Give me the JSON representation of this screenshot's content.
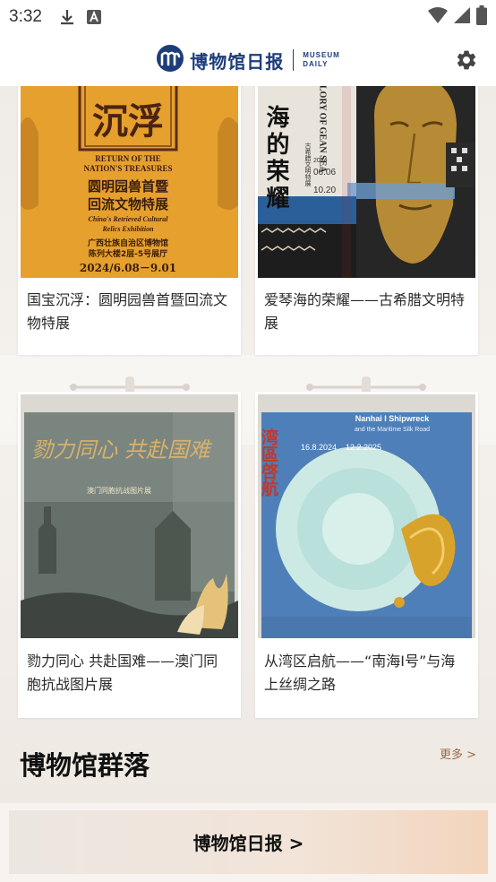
{
  "status_bar": {
    "time": "3:32"
  },
  "header": {
    "logo_cn": "博物馆日报",
    "logo_en_line1": "MUSEUM",
    "logo_en_line2": "DAILY"
  },
  "exhibitions": [
    {
      "title": "国宝沉浮：圆明园兽首暨回流文物特展",
      "poster": {
        "cn_big": "沉浮",
        "en_line1": "RETURN OF THE",
        "en_line2": "NATION'S TREASURES",
        "cn_sub1": "圆明园兽首暨",
        "cn_sub2": "回流文物特展",
        "en_sub1": "China's Retrieved Cultural",
        "en_sub2": "Relics Exhibition",
        "venue1": "广西壮族自治区博物馆",
        "venue2": "陈列大楼2层-5号展厅",
        "dates": "2024/6.08－9.01"
      }
    },
    {
      "title": "爱琴海的荣耀——古希腊文明特展",
      "poster": {
        "cn_big": "海的荣耀",
        "en": "LORY OF GEAN SEA",
        "cn_small": "古希腊文明特展",
        "year": "2024",
        "date1": "06.06",
        "date2": "10.20"
      }
    },
    {
      "title": "勠力同心 共赴国难——澳门同胞抗战图片展",
      "poster": {
        "calligraphy": "勠力同心 共赴国难",
        "subtitle": "澳门同胞抗战图片展"
      }
    },
    {
      "title": "从湾区启航——“南海I号”与海上丝绸之路",
      "poster": {
        "cn_big": "湾區啓航",
        "en1": "Nanhai I Shipwreck",
        "en2": "and the Maritime Silk Road",
        "date1": "16.8.2024",
        "date2": "12.2.2025"
      }
    }
  ],
  "section": {
    "title": "博物馆群落",
    "more": "更多 >"
  },
  "bottom": {
    "label": "博物馆日报 >"
  },
  "colors": {
    "brand": "#1d3c7a",
    "accent": "#9a6a48",
    "poster1_bg": "#e6a02e"
  }
}
